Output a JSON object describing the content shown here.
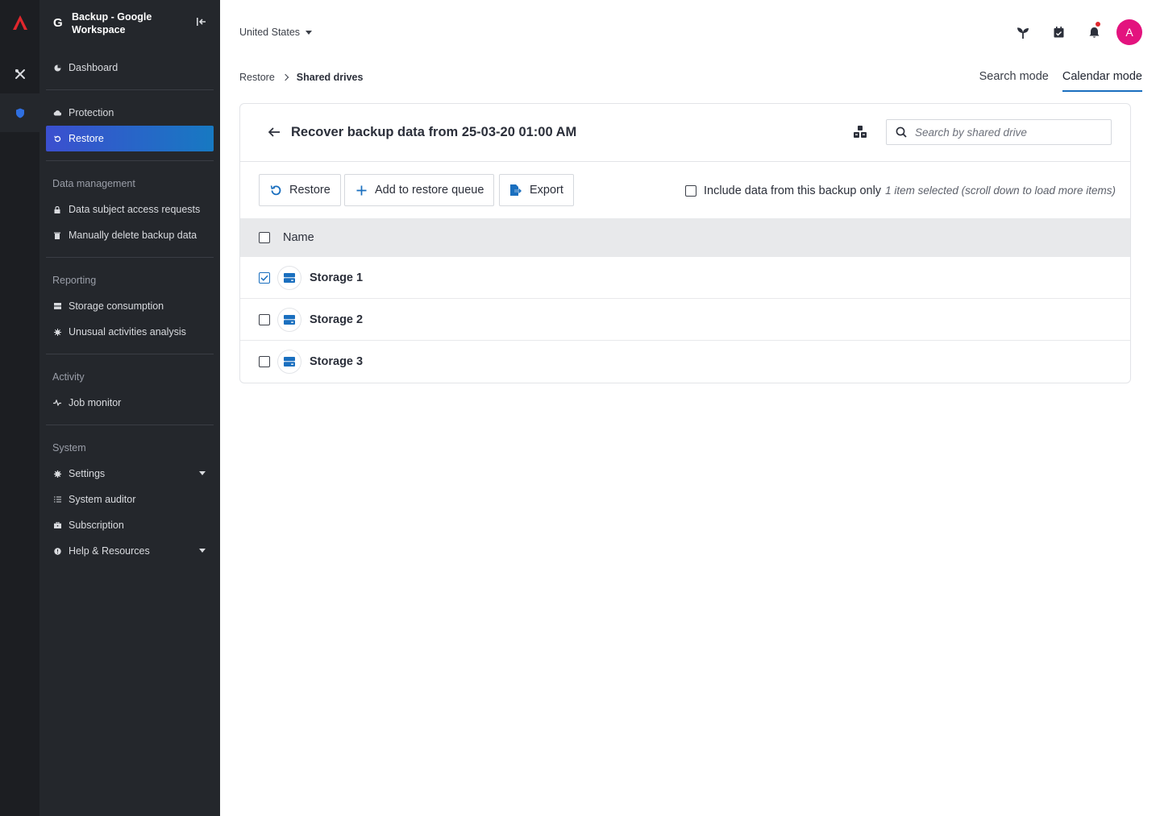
{
  "sidebar": {
    "app_letter": "G",
    "app_title": "Backup - Google Workspace",
    "items": {
      "dashboard": "Dashboard",
      "protection": "Protection",
      "restore": "Restore",
      "dsar": "Data subject access requests",
      "manual_delete": "Manually delete backup data",
      "storage": "Storage consumption",
      "unusual": "Unusual activities analysis",
      "job_monitor": "Job monitor",
      "settings": "Settings",
      "auditor": "System auditor",
      "subscription": "Subscription",
      "help": "Help & Resources"
    },
    "sections": {
      "data_management": "Data management",
      "reporting": "Reporting",
      "activity": "Activity",
      "system": "System"
    }
  },
  "header": {
    "region": "United States",
    "avatar_letter": "A",
    "accent": "#e3137e"
  },
  "breadcrumb": {
    "parent": "Restore",
    "current": "Shared drives"
  },
  "mode_tabs": {
    "search": "Search mode",
    "calendar": "Calendar mode",
    "active": "calendar"
  },
  "card": {
    "title": "Recover backup data from 25-03-20 01:00 AM",
    "search_placeholder": "Search by shared drive"
  },
  "toolbar": {
    "restore": "Restore",
    "add_queue": "Add to restore queue",
    "export": "Export",
    "include_only": "Include data from this backup only",
    "selection_info": "1 item selected (scroll down to load more items)"
  },
  "table": {
    "column_name": "Name",
    "rows": [
      {
        "name": "Storage 1",
        "checked": true
      },
      {
        "name": "Storage 2",
        "checked": false
      },
      {
        "name": "Storage 3",
        "checked": false
      }
    ]
  },
  "colors": {
    "primary": "#1a6fbf",
    "sidebar_bg": "#24272c",
    "rail_bg": "#1c1e22"
  }
}
